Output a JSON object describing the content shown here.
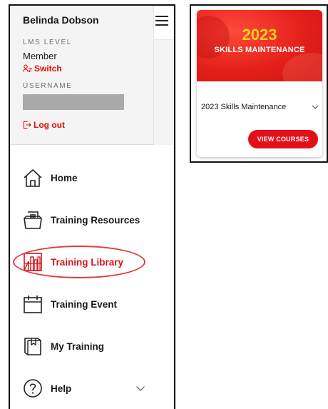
{
  "profile": {
    "name": "Belinda Dobson",
    "lms_level_label": "LMS LEVEL",
    "lms_level_value": "Member",
    "switch_label": "Switch",
    "username_label": "USERNAME",
    "logout_label": "Log out"
  },
  "nav": {
    "items": [
      {
        "label": "Home",
        "icon": "home-icon"
      },
      {
        "label": "Training Resources",
        "icon": "folder-icon"
      },
      {
        "label": "Training Library",
        "icon": "library-icon",
        "active": true
      },
      {
        "label": "Training Event",
        "icon": "calendar-icon"
      },
      {
        "label": "My Training",
        "icon": "book-icon"
      },
      {
        "label": "Help",
        "icon": "question-icon"
      }
    ]
  },
  "course_card": {
    "banner_year": "2023",
    "banner_title": "SKILLS MAINTENANCE",
    "selected_course": "2023 Skills Maintenance",
    "button_label": "VIEW COURSES"
  },
  "colors": {
    "accent_red": "#e3101a",
    "banner_year_yellow": "#ffd21a",
    "highlight_oval": "#e23b3b"
  }
}
